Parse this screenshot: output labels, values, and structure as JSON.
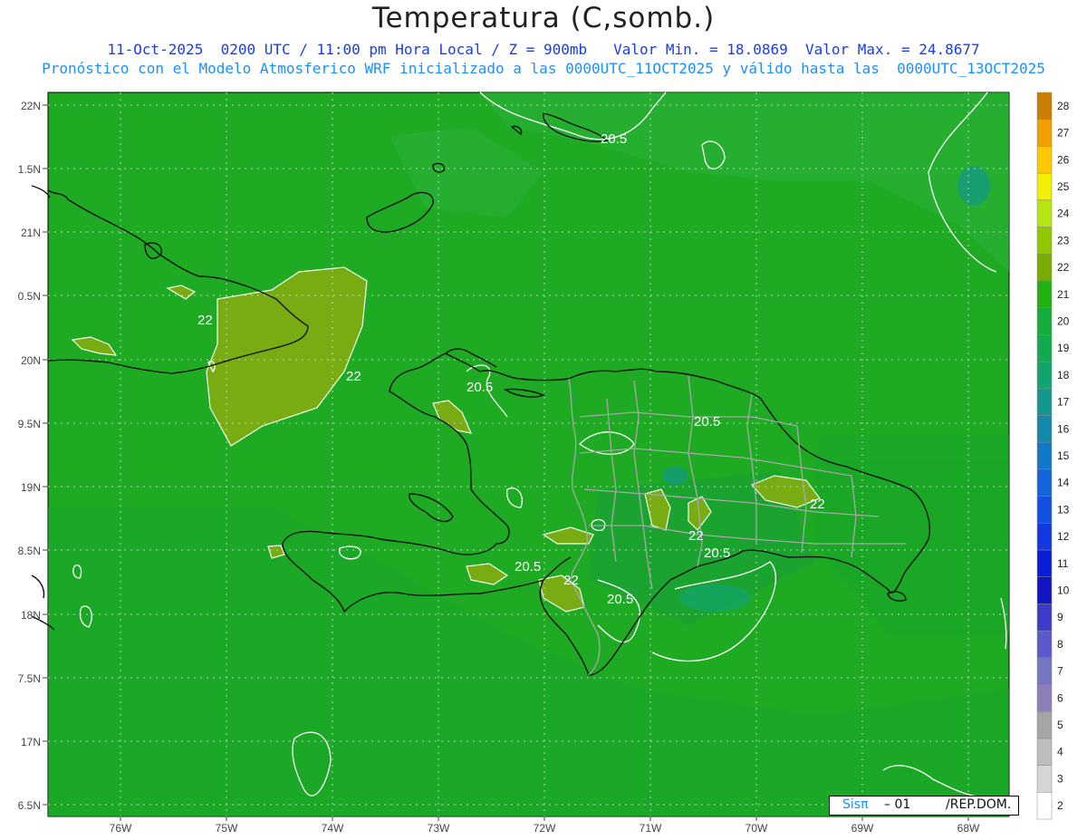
{
  "header": {
    "title": "Temperatura (C,somb.)",
    "line1": "11-Oct-2025  0200 UTC / 11:00 pm Hora Local / Z = 900mb   Valor Min. = 18.0869  Valor Max. = 24.8677",
    "line2": "Pronóstico con el Modelo Atmosferico WRF inicializado a las 0000UTC_11OCT2025 y válido hasta las  0000UTC_13OCT2025"
  },
  "footer": {
    "brand": "Sisπ",
    "code": "– 01",
    "region": "/REP.DOM."
  },
  "axes": {
    "lat_labels": [
      "22N",
      "1.5N",
      "21N",
      "0.5N",
      "20N",
      "9.5N",
      "19N",
      "8.5N",
      "18N",
      "7.5N",
      "17N",
      "6.5N"
    ],
    "lon_labels": [
      "76W",
      "75W",
      "74W",
      "73W",
      "72W",
      "71W",
      "70W",
      "69W",
      "68W"
    ]
  },
  "legend": {
    "values": [
      "2",
      "3",
      "4",
      "5",
      "6",
      "7",
      "8",
      "9",
      "10",
      "11",
      "12",
      "13",
      "14",
      "15",
      "16",
      "17",
      "18",
      "19",
      "20",
      "21",
      "22",
      "23",
      "24",
      "25",
      "26",
      "27",
      "28"
    ],
    "colors": [
      "#ffffff",
      "#d6d6d6",
      "#bdbdbd",
      "#a5a5a5",
      "#8c7fb5",
      "#7575c0",
      "#5a5acc",
      "#3c3cc8",
      "#1414c0",
      "#0a1ed6",
      "#1438e0",
      "#1450e0",
      "#1464dc",
      "#1478c8",
      "#148aa8",
      "#14978c",
      "#14a46e",
      "#14aa50",
      "#16ac3c",
      "#22b012",
      "#78ac00",
      "#8fc800",
      "#b4e614",
      "#f0f000",
      "#ffc800",
      "#f0a000",
      "#c87e00"
    ]
  },
  "contour_labels": [
    {
      "text": "20.5"
    },
    {
      "text": "22"
    },
    {
      "text": "22"
    },
    {
      "text": "20.5"
    },
    {
      "text": "20.5"
    },
    {
      "text": "22"
    },
    {
      "text": "22"
    },
    {
      "text": "20.5"
    },
    {
      "text": "20.5"
    },
    {
      "text": "22"
    },
    {
      "text": "20.5"
    }
  ],
  "colors": {
    "land_fill": "#1eaa22",
    "warm_patch": "#78ac12",
    "title": "#1a3cf0",
    "subtitle": "#1e8fff"
  }
}
